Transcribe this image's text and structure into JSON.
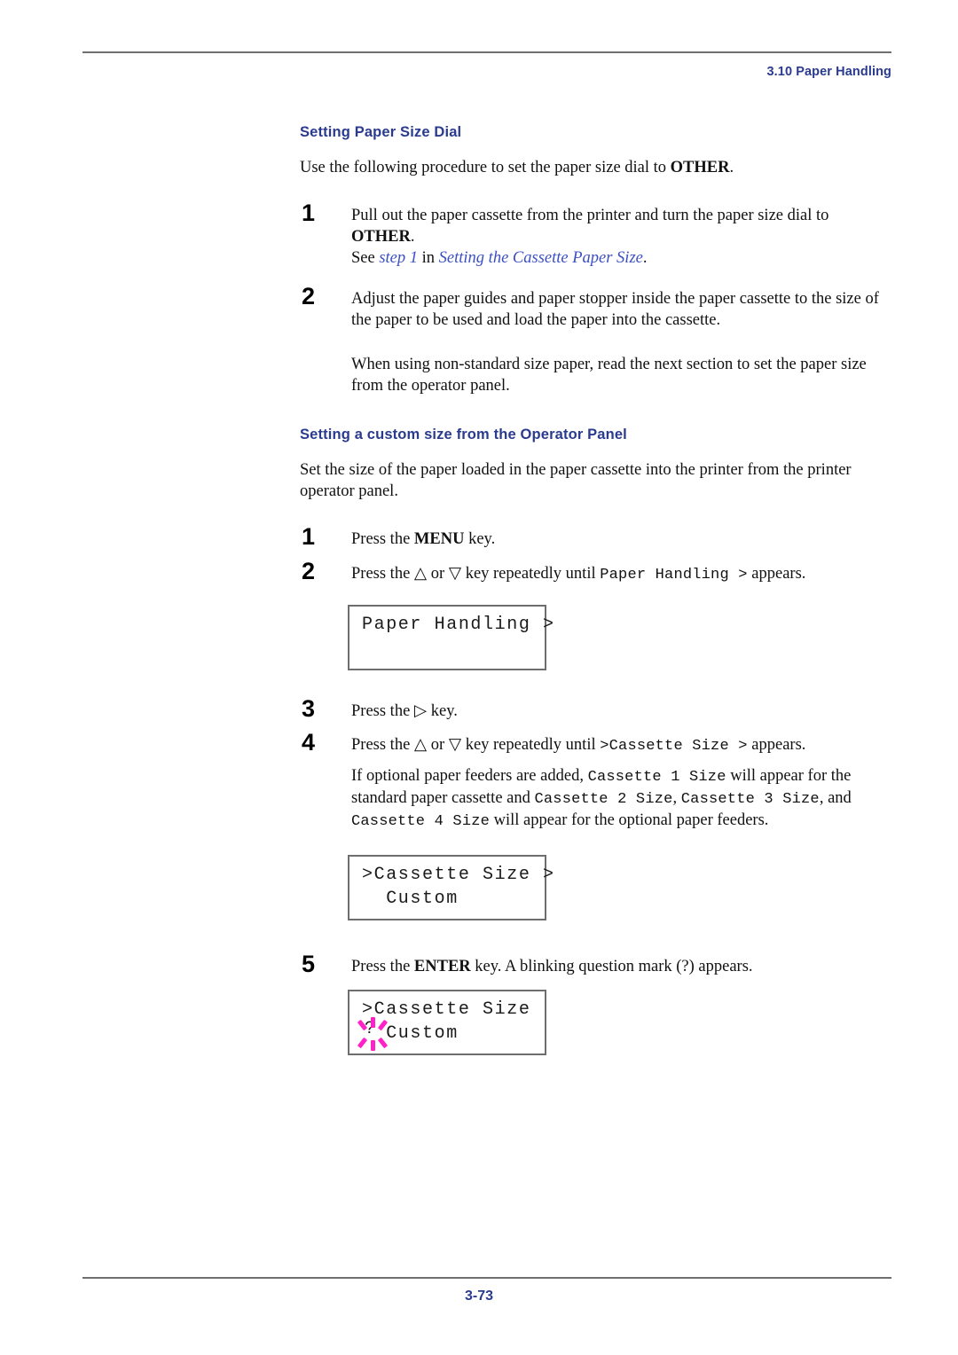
{
  "page": {
    "header_title": "3.10 Paper Handling",
    "footer_page": "3-73"
  },
  "section1": {
    "heading": "Setting Paper Size Dial",
    "intro_pre": "Use the following procedure to set the paper size dial to ",
    "intro_bold": "OTHER",
    "intro_post": ".",
    "steps": [
      {
        "num": "1",
        "line1_pre": "Pull out the paper cassette from the printer and turn the paper size dial to ",
        "line1_bold": "OTHER",
        "line1_post": ".",
        "line2_pre": "See ",
        "line2_xref1": "step 1",
        "line2_mid": " in ",
        "line2_xref2": "Setting the Cassette Paper Size",
        "line2_post": "."
      },
      {
        "num": "2",
        "text": "Adjust the paper guides and paper stopper inside the paper cassette to the size of the paper to be used and load the paper into the cassette."
      }
    ],
    "note": "When using non-standard size paper, read the next section to set the paper size from the operator panel."
  },
  "section2": {
    "heading": "Setting a custom size from the Operator Panel",
    "intro": "Set the size of the paper loaded in the paper cassette into the printer from the printer operator panel.",
    "step1": {
      "num": "1",
      "pre": "Press the ",
      "key": "MENU",
      "post": " key."
    },
    "step2": {
      "num": "2",
      "pre": "Press the ",
      "up_key": "△",
      "mid": " or ",
      "down_key": "▽",
      "post": " key repeatedly until ",
      "mono": "Paper Handling >",
      "tail": " appears."
    },
    "lcd1": {
      "line1": "Paper Handling >",
      "line2": ""
    },
    "step3": {
      "num": "3",
      "pre": "Press the ",
      "right_key": "▷",
      "post": " key."
    },
    "step4": {
      "num": "4",
      "pre": "Press the ",
      "up_key": "△",
      "mid": " or ",
      "down_key": "▽",
      "post": " key repeatedly until ",
      "mono": ">Cassette Size >",
      "tail": " appears."
    },
    "feeder_note": {
      "p1": "If optional paper feeders are added, ",
      "m1": "Cassette 1 Size",
      "p2": " will appear for the standard paper cassette and ",
      "m2": "Cassette 2 Size",
      "p3": ", ",
      "m3": "Cassette 3 Size",
      "p4": ", and ",
      "m4": "Cassette 4 Size",
      "p5": " will appear for the optional paper feeders."
    },
    "lcd2": {
      "line1": ">Cassette Size >",
      "line2": "  Custom"
    },
    "step5": {
      "num": "5",
      "pre": "Press the ",
      "key": "ENTER",
      "post": " key. A blinking question mark (?) appears."
    },
    "lcd3": {
      "line1": ">Cassette Size",
      "line2": "  Custom",
      "blink_char": "?",
      "blink_color": "#ff22c8"
    }
  }
}
